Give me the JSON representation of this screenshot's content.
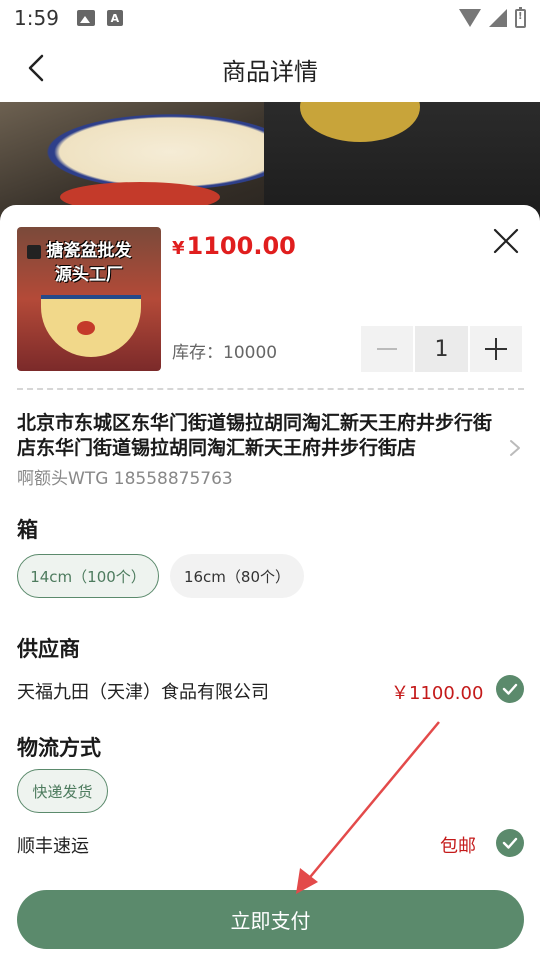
{
  "status_bar": {
    "time": "1:59",
    "a_glyph": "A"
  },
  "header": {
    "title": "商品详情"
  },
  "product": {
    "thumbnail_caption": "搪瓷盆批发\n源头工厂",
    "currency": "¥",
    "price": "1100.00",
    "stock_label": "库存：",
    "stock_value": "10000",
    "quantity": "1"
  },
  "address": {
    "text": "北京市东城区东华门街道锡拉胡同淘汇新天王府井步行街店东华门街道锡拉胡同淘汇新天王府井步行街店",
    "contact": "啊额头WTG  18558875763"
  },
  "spec": {
    "title": "箱",
    "options": [
      {
        "label": "14cm（100个）",
        "selected": true
      },
      {
        "label": "16cm（80个）",
        "selected": false
      }
    ]
  },
  "supplier": {
    "title": "供应商",
    "name": "天福九田（天津）食品有限公司",
    "price": "￥1100.00"
  },
  "logistics": {
    "title": "物流方式",
    "method": "快递发货",
    "carrier": "顺丰速运",
    "shipping_fee": "包邮"
  },
  "actions": {
    "pay_label": "立即支付"
  },
  "colors": {
    "accent": "#5b8a6c",
    "price_red": "#e01e1e",
    "annotation_arrow": "#e34a4a"
  }
}
